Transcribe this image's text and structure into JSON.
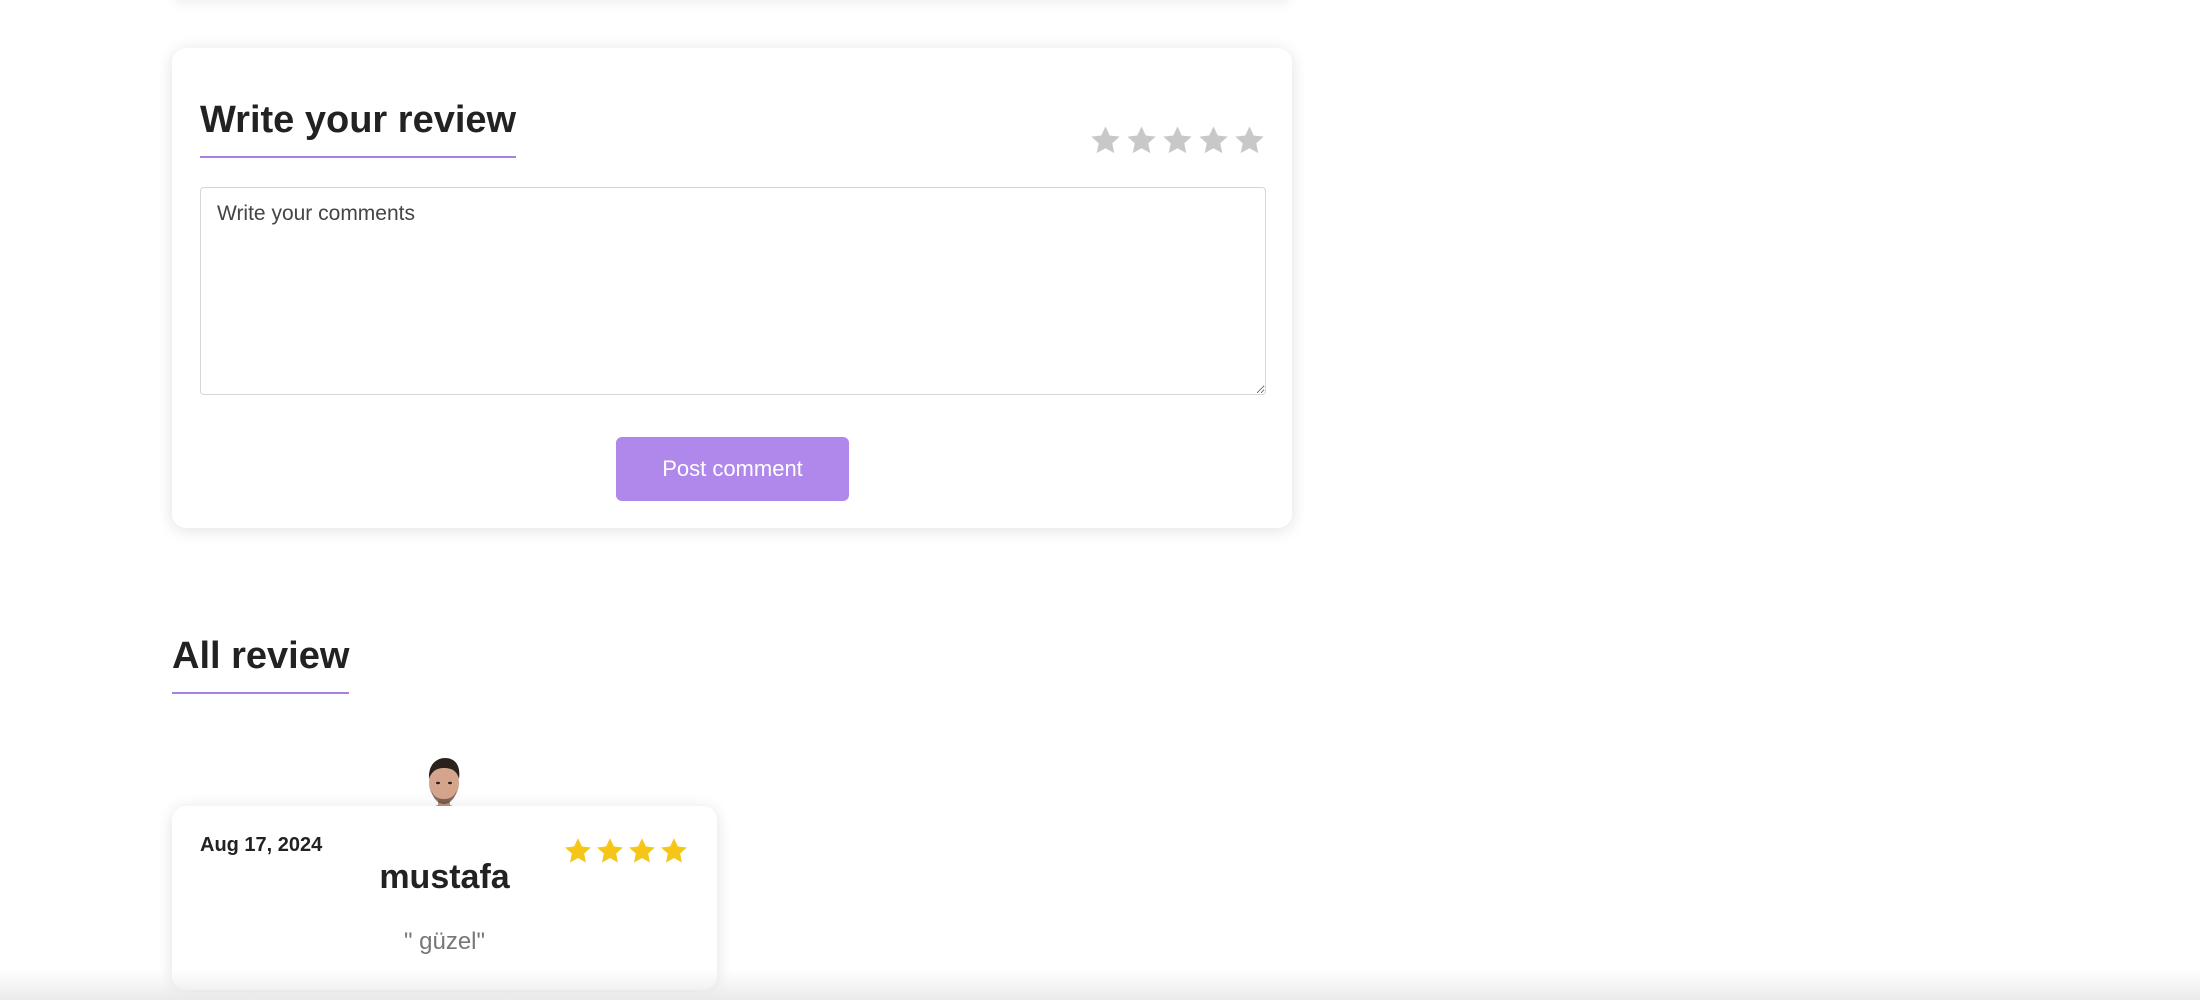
{
  "review_form": {
    "title": "Write your review",
    "rating_value": 0,
    "rating_max": 5,
    "star_empty_color": "#c8c8c8",
    "comment_placeholder": "Write your comments",
    "comment_value": "",
    "post_button_label": "Post comment",
    "accent_color": "#b087eb"
  },
  "all_reviews": {
    "title": "All review",
    "items": [
      {
        "date": "Aug 17, 2024",
        "name": "mustafa",
        "text": "\" güzel\"",
        "rating": 4,
        "star_color": "#f5c518",
        "avatar_icon": "user-photo"
      }
    ]
  }
}
